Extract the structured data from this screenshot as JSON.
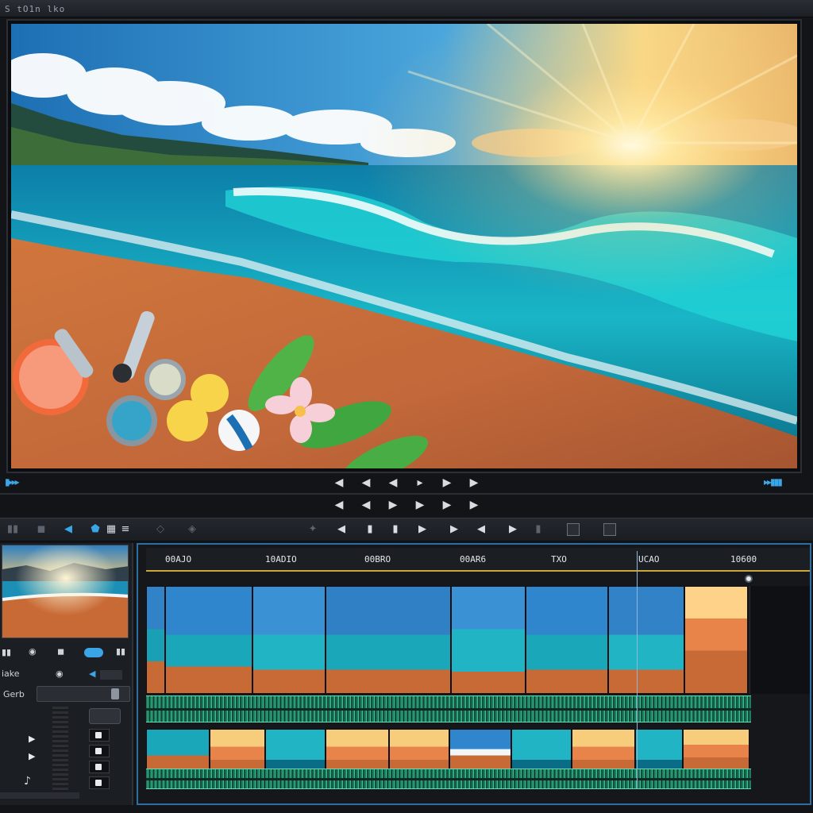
{
  "app": {
    "title": "S tO1n lko"
  },
  "preview": {
    "scene": "beach-sunset-frame"
  },
  "transport": {
    "row1": [
      "◀",
      "◀",
      "◀",
      "▸",
      "▶",
      "▶"
    ],
    "row2": [
      "◀",
      "◀",
      "▶",
      "▶",
      "▶",
      "▶"
    ]
  },
  "toolbar": {
    "items": [
      "◀",
      "▮",
      "▮",
      "▶",
      "▶",
      "◀",
      "▶",
      "▮"
    ]
  },
  "left_panel": {
    "label_row": "iake",
    "field_label": "Gerb"
  },
  "timeline": {
    "ticks": [
      "00AJO",
      "10ADIO",
      "00BRO",
      "00AR6",
      "TXO",
      "UCAO",
      "10600"
    ]
  },
  "colors": {
    "accent": "#3aa6e8",
    "ruler": "#c9a63a",
    "wave": "#35c496",
    "border": "#2e6fa3"
  }
}
